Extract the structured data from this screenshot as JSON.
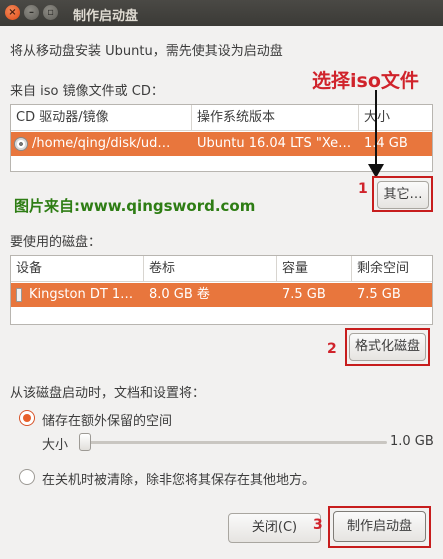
{
  "window": {
    "title": "制作启动盘"
  },
  "intro_text": "将从移动盘安装 Ubuntu，需先使其设为启动盘",
  "source": {
    "label": "来自 iso 镜像文件或 CD：",
    "columns": [
      "CD 驱动器/镜像",
      "操作系统版本",
      "大小"
    ],
    "row": {
      "path": "/home/qing/disk/ud…",
      "os": "Ubuntu 16.04 LTS \"Xe…",
      "size": "1.4 GB"
    },
    "other_button": "其它…"
  },
  "disk": {
    "label": "要使用的磁盘：",
    "columns": [
      "设备",
      "卷标",
      "容量",
      "剩余空间"
    ],
    "row": {
      "device": "Kingston DT 1…",
      "volume": "8.0 GB 卷",
      "capacity": "7.5 GB",
      "free": "7.5 GB"
    },
    "format_button": "格式化磁盘"
  },
  "options": {
    "label": "从该磁盘启动时，文档和设置将：",
    "store_option": "储存在额外保留的空间",
    "size_label": "大小",
    "size_value": "1.0 GB",
    "size_fraction": 0.0,
    "discard_option": "在关机时被清除，除非您将其保存在其他地方。"
  },
  "buttons": {
    "close": "关闭(C)",
    "make": "制作启动盘"
  },
  "annotations": {
    "select_iso": "选择iso文件",
    "step1": "1",
    "step2": "2",
    "step3": "3",
    "watermark": "图片来自:www.qingsword.com"
  },
  "colors": {
    "selection": "#e8763d",
    "annotation_red": "#d0232b",
    "watermark_green": "#2e7d14"
  }
}
